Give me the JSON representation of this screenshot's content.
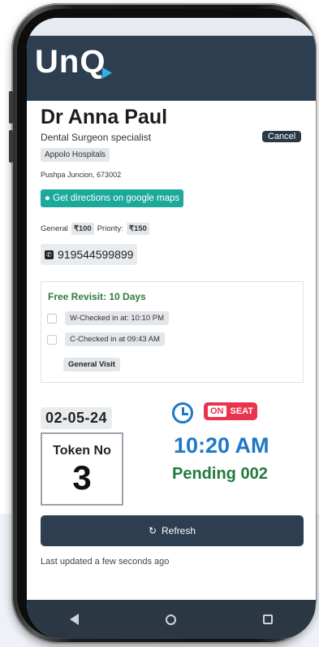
{
  "app": {
    "logo_text": "Un",
    "logo_q": "Q"
  },
  "doctor": {
    "name": "Dr Anna Paul",
    "specialty": "Dental Surgeon specialist",
    "hospital": "Appolo Hospitals",
    "address": "Pushpa Juncion, 673002",
    "maps_label": "Get directions on google maps",
    "phone": "919544599899"
  },
  "actions": {
    "cancel_label": "Cancel",
    "refresh_label": "Refresh"
  },
  "fees": {
    "general_label": "General",
    "general_value": "₹100",
    "priority_label": "Priority:",
    "priority_value": "₹150"
  },
  "revisit": {
    "title": "Free Revisit: 10 Days",
    "checks": [
      {
        "label": "W-Checked in at: 10:10 PM",
        "checked": false
      },
      {
        "label": "C-Checked in at 09:43 AM",
        "checked": false
      }
    ],
    "visit_type": "General Visit"
  },
  "token": {
    "date": "02-05-24",
    "label": "Token No",
    "number": "3"
  },
  "status": {
    "on_label": "ON",
    "seat_label": "SEAT",
    "time": "10:20 AM",
    "pending": "Pending 002"
  },
  "last_updated": "Last updated a few seconds ago",
  "colors": {
    "header": "#2d3e50",
    "maps_button": "#1aa99a",
    "time_blue": "#1e78c8",
    "pending_green": "#207a3f",
    "onseat_red": "#e8344e"
  },
  "icons": {
    "maps": "map-marker-icon",
    "phone": "phone-icon",
    "clock": "clock-icon",
    "refresh": "refresh-icon"
  }
}
